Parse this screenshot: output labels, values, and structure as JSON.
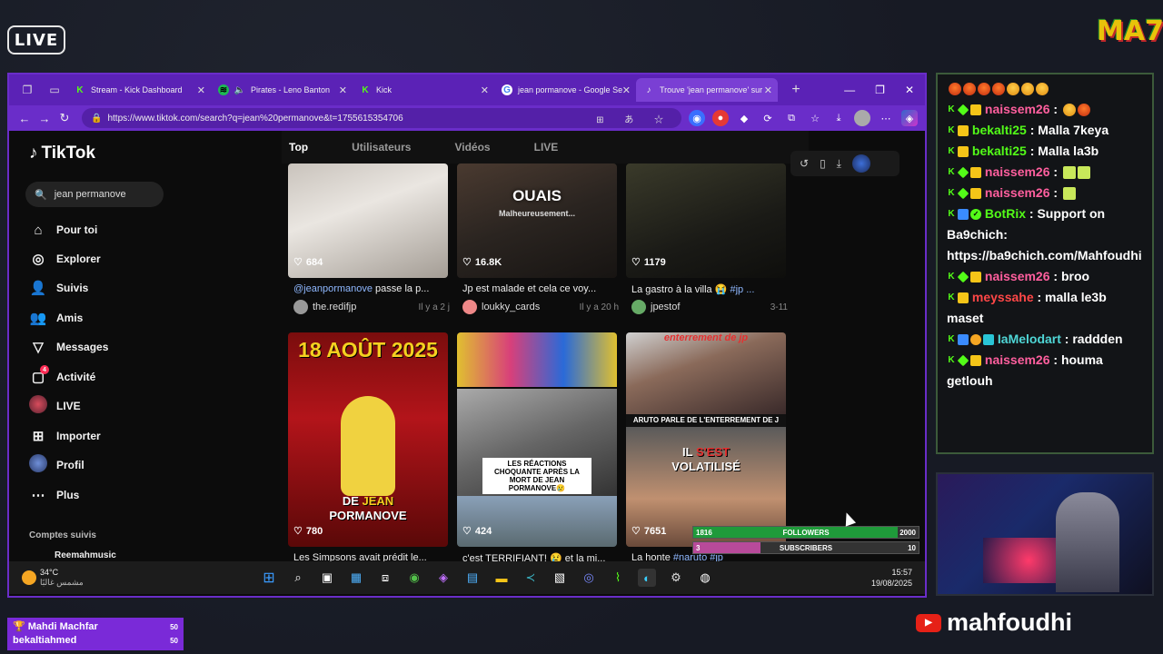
{
  "overlay": {
    "live_label": "LIVE",
    "brand_logo": "MA7",
    "youtube_handle": "mahfoudhi"
  },
  "browser": {
    "tabs": [
      {
        "label": "Stream - Kick Dashboard",
        "icon": "kick-icon"
      },
      {
        "label": "Pirates - Leno Banton",
        "icon": "spotify-icon"
      },
      {
        "label": "Kick",
        "icon": "kick-icon"
      },
      {
        "label": "jean pormanove - Google Se",
        "icon": "google-icon"
      },
      {
        "label": "Trouve 'jean permanove' sur",
        "icon": "tiktok-icon",
        "active": true
      }
    ],
    "url": "https://www.tiktok.com/search?q=jean%20permanove&t=1755615354706"
  },
  "tiktok": {
    "logo_text": "TikTok",
    "search_value": "jean permanove",
    "nav": [
      {
        "label": "Pour toi",
        "icon": "home-icon"
      },
      {
        "label": "Explorer",
        "icon": "compass-icon"
      },
      {
        "label": "Suivis",
        "icon": "following-icon"
      },
      {
        "label": "Amis",
        "icon": "friends-icon"
      },
      {
        "label": "Messages",
        "icon": "messages-icon"
      },
      {
        "label": "Activité",
        "icon": "activity-icon",
        "badge": "4"
      },
      {
        "label": "LIVE",
        "icon": "live-icon"
      },
      {
        "label": "Importer",
        "icon": "upload-icon"
      },
      {
        "label": "Profil",
        "icon": "profile-icon"
      },
      {
        "label": "Plus",
        "icon": "more-icon"
      }
    ],
    "followed_heading": "Comptes suivis",
    "followed_first": "Reemahmusic",
    "search_tabs": [
      "Top",
      "Utilisateurs",
      "Vidéos",
      "LIVE"
    ],
    "videos_row1": [
      {
        "likes": "684",
        "caption_mention": "@jeanpormanove",
        "caption_rest": " passe la p...",
        "author": "the.redifjp",
        "time": "Il y a 2 j",
        "overlay": ""
      },
      {
        "likes": "16.8K",
        "caption_rest": "Jp est malade et cela ce voy...",
        "author": "loukky_cards",
        "time": "Il y a 20 h",
        "overlay": "OUAIS",
        "overlay_sub": "Malheureusement..."
      },
      {
        "likes": "1179",
        "caption_rest": "La gastro à la villa 😭 ",
        "caption_hashtag": "#jp ...",
        "author": "jpestof",
        "time": "3-11",
        "overlay": ""
      }
    ],
    "videos_row2": [
      {
        "likes": "780",
        "caption_rest": "Les Simpsons avait prédit le...",
        "overlay_top": "18 AOÛT 2025",
        "overlay_bottom_a": "DE ",
        "overlay_bottom_b": "JEAN",
        "overlay_bottom_c": "PORMANOVE"
      },
      {
        "likes": "424",
        "caption_rest": "c'est TERRIFIANT! 😢 et la mi...",
        "overlay": "LES RÉACTIONS CHOQUANTE APRÈS LA MORT DE JEAN PORMANOVE😢"
      },
      {
        "likes": "7651",
        "caption_rest": "La honte ",
        "caption_hashtag": "#naruto #jp",
        "overlay_top": "enterrement de jp",
        "overlay_band": "ARUTO PARLE DE L'ENTERREMENT DE J",
        "overlay_a": "IL ",
        "overlay_b": "S'EST",
        "overlay_c": "VOLATILISÉ"
      }
    ]
  },
  "goals": {
    "followers": {
      "current": "1816",
      "label": "FOLLOWERS",
      "target": "2000",
      "fraction": 0.908,
      "color": "#1f9a3a"
    },
    "subscribers": {
      "current": "3",
      "label": "SUBSCRIBERS",
      "target": "10",
      "fraction": 0.3,
      "color": "#b84a9a"
    }
  },
  "taskbar": {
    "temperature": "34°C",
    "weather_text": "مشمس غالبًا",
    "time": "15:57",
    "date": "19/08/2025"
  },
  "chat": {
    "messages": [
      {
        "user": "naissem26",
        "color": "user-pink",
        "text": " : ",
        "badges": [
          "k",
          "g",
          "c"
        ],
        "emojis": [
          "em-sad",
          "em-angry"
        ]
      },
      {
        "user": "bekalti25",
        "color": "user-green",
        "text": " : Malla 7keya",
        "badges": [
          "k",
          "c"
        ]
      },
      {
        "user": "bekalti25",
        "color": "user-green",
        "text": " : Malla la3b",
        "badges": [
          "k",
          "c"
        ]
      },
      {
        "user": "naissem26",
        "color": "user-pink",
        "text": " : ",
        "badges": [
          "k",
          "g",
          "c"
        ],
        "emojis": [
          "em-sign",
          "em-sign"
        ]
      },
      {
        "user": "naissem26",
        "color": "user-pink",
        "text": " : ",
        "badges": [
          "k",
          "g",
          "c"
        ],
        "emojis": [
          "em-sign"
        ]
      },
      {
        "user": "BotRix",
        "color": "user-green",
        "text": " : Support on Ba9chich: https://ba9chich.com/Mahfoudhi",
        "badges": [
          "k",
          "b",
          "v"
        ]
      },
      {
        "user": "naissem26",
        "color": "user-pink",
        "text": " : broo",
        "badges": [
          "k",
          "g",
          "c"
        ]
      },
      {
        "user": "meyssahe",
        "color": "user-red",
        "text": " : malla le3b maset",
        "badges": [
          "k",
          "c"
        ]
      },
      {
        "user": "IaMelodart",
        "color": "user-teal",
        "text": " : raddden",
        "badges": [
          "k",
          "b",
          "o",
          "t"
        ]
      },
      {
        "user": "naissem26",
        "color": "user-pink",
        "text": " : houma getlouh",
        "badges": [
          "k",
          "g",
          "c"
        ]
      }
    ]
  },
  "alert": {
    "rows": [
      {
        "name": "Mahdi Machfar",
        "value": "50"
      },
      {
        "name": "bekaltiahmed",
        "value": "50"
      }
    ]
  }
}
